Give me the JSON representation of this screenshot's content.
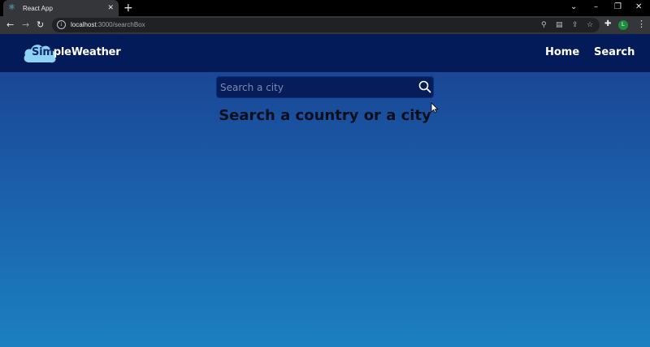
{
  "browser": {
    "tab_title": "React App",
    "url_host": "localhost",
    "url_path": ":3000/searchBox",
    "profile_initial": "L"
  },
  "app": {
    "logo_prefix": "Sim",
    "logo_suffix": "pleWeather",
    "nav": [
      {
        "label": "Home"
      },
      {
        "label": "Search"
      }
    ]
  },
  "search": {
    "placeholder": "Search a city",
    "value": "",
    "heading": "Search a country or a city"
  },
  "colors": {
    "navbar": "#031b59",
    "gradient_top": "#1a3f8f",
    "gradient_bottom": "#1b80c0",
    "search_box": "#061d5a"
  },
  "icons": {
    "search": "search-icon",
    "logo": "cloud-icon"
  }
}
